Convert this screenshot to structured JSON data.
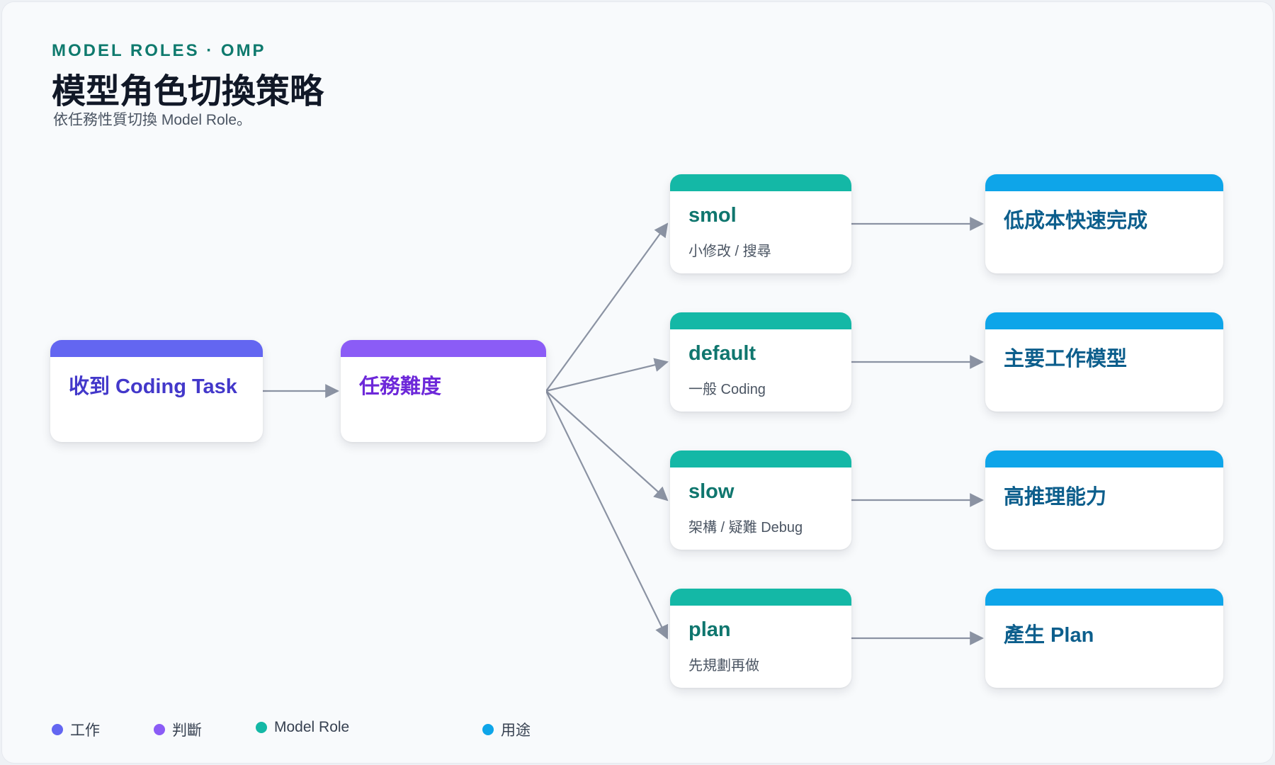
{
  "header": {
    "eyebrow": "MODEL ROLES · OMP",
    "title": "模型角色切換策略",
    "subtitle": "依任務性質切換 Model Role。"
  },
  "nodes": {
    "task": {
      "label": "收到 Coding Task",
      "kind": "work"
    },
    "decide": {
      "label": "任務難度",
      "kind": "decide"
    },
    "smol": {
      "label": "smol",
      "desc": "小修改 / 搜尋",
      "kind": "role"
    },
    "default": {
      "label": "default",
      "desc": "一般 Coding",
      "kind": "role"
    },
    "slow": {
      "label": "slow",
      "desc": "架構 / 疑難 Debug",
      "kind": "role"
    },
    "plan": {
      "label": "plan",
      "desc": "先規劃再做",
      "kind": "role"
    },
    "use_smol": {
      "label": "低成本快速完成",
      "kind": "use"
    },
    "use_default": {
      "label": "主要工作模型",
      "kind": "use"
    },
    "use_slow": {
      "label": "高推理能力",
      "kind": "use"
    },
    "use_plan": {
      "label": "產生 Plan",
      "kind": "use"
    }
  },
  "edges": [
    {
      "from": "task",
      "to": "decide"
    },
    {
      "from": "decide",
      "to": "smol"
    },
    {
      "from": "decide",
      "to": "default"
    },
    {
      "from": "decide",
      "to": "slow"
    },
    {
      "from": "decide",
      "to": "plan"
    },
    {
      "from": "smol",
      "to": "use_smol"
    },
    {
      "from": "default",
      "to": "use_default"
    },
    {
      "from": "slow",
      "to": "use_slow"
    },
    {
      "from": "plan",
      "to": "use_plan"
    }
  ],
  "legend": {
    "work": "工作",
    "decide": "判斷",
    "role": "Model Role",
    "use": "用途"
  },
  "colors": {
    "work": "#6366f1",
    "decide": "#8b5cf6",
    "role": "#14b8a6",
    "use": "#0ea5e9",
    "edge": "#8b93a3"
  }
}
